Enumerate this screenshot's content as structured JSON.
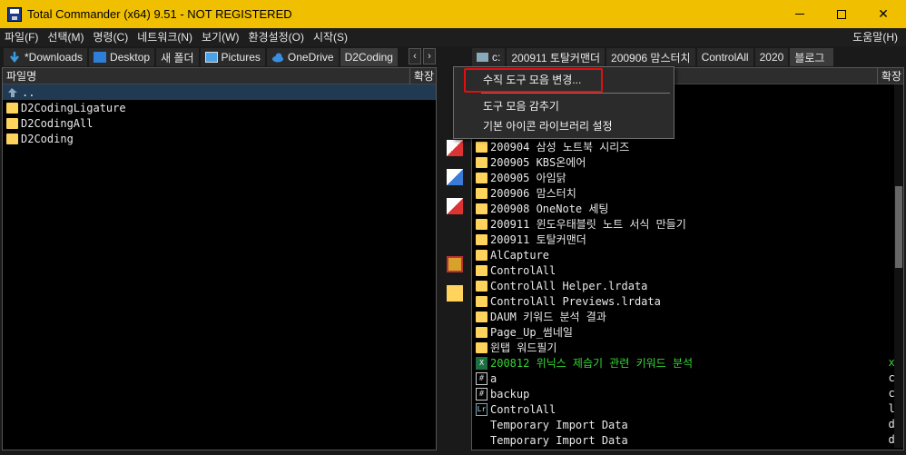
{
  "titlebar": {
    "title": "Total Commander (x64) 9.51 - NOT REGISTERED",
    "minimize_icon": "minimize-icon",
    "maximize_icon": "maximize-icon",
    "close_icon": "close-icon",
    "close_glyph": "✕"
  },
  "menubar": {
    "items": [
      "파일(F)",
      "선택(M)",
      "명령(C)",
      "네트워크(N)",
      "보기(W)",
      "환경설정(O)",
      "시작(S)"
    ],
    "help": "도움말(H)"
  },
  "left_tabs": [
    {
      "label": "*Downloads",
      "icon": "download-arrow-icon",
      "color": "#3a9be0"
    },
    {
      "label": "Desktop",
      "icon": "desktop-icon",
      "color": "#2f7fd8"
    },
    {
      "label": "새 폴더",
      "icon": ""
    },
    {
      "label": "Pictures",
      "icon": "pictures-icon",
      "color": "#4aa3e8"
    },
    {
      "label": "OneDrive",
      "icon": "cloud-icon",
      "color": "#3b8ee0"
    },
    {
      "label": "D2Coding",
      "icon": "",
      "active": true
    }
  ],
  "tab_arrows": {
    "prev": "‹",
    "next": "›"
  },
  "right_tabs": [
    {
      "label": "c:",
      "icon": "drive-icon"
    },
    {
      "label": "200911 토탈커맨더"
    },
    {
      "label": "200906 맘스터치"
    },
    {
      "label": "ControlAll"
    },
    {
      "label": "2020"
    },
    {
      "label": "블로그",
      "active": true
    }
  ],
  "left_panel": {
    "col_name": "파일명",
    "col_ext": "확장",
    "up_label": "..",
    "items": [
      {
        "name": "D2CodingLigature"
      },
      {
        "name": "D2CodingAll"
      },
      {
        "name": "D2Coding"
      }
    ]
  },
  "right_panel": {
    "col_ext": "확장",
    "items": [
      {
        "name": "200904 삼성 노트북 시리즈",
        "type": "folder"
      },
      {
        "name": "200905 KBS온에어",
        "type": "folder"
      },
      {
        "name": "200905 아임닭",
        "type": "folder"
      },
      {
        "name": "200906 맘스터치",
        "type": "folder"
      },
      {
        "name": "200908 OneNote 세팅",
        "type": "folder"
      },
      {
        "name": "200911 윈도우태블릿 노트 서식 만들기",
        "type": "folder"
      },
      {
        "name": "200911 토탈커맨더",
        "type": "folder"
      },
      {
        "name": "AlCapture",
        "type": "folder"
      },
      {
        "name": "ControlAll",
        "type": "folder"
      },
      {
        "name": "ControlAll Helper.lrdata",
        "type": "folder"
      },
      {
        "name": "ControlAll Previews.lrdata",
        "type": "folder"
      },
      {
        "name": "DAUM 키워드 분석 결과",
        "type": "folder"
      },
      {
        "name": "Page_Up_썸네일",
        "type": "folder"
      },
      {
        "name": "윈탭 워드필기",
        "type": "folder"
      },
      {
        "name": "200812 위닉스 제습기 관련 키워드 분석",
        "type": "xl",
        "ext": "xl",
        "green": true
      },
      {
        "name": "a",
        "type": "file",
        "ext": "cs"
      },
      {
        "name": "backup",
        "type": "file",
        "ext": "cs"
      },
      {
        "name": "ControlAll",
        "type": "lr",
        "ext": "lr"
      },
      {
        "name": "Temporary Import Data",
        "type": "plain",
        "ext": "db"
      },
      {
        "name": "Temporary Import Data",
        "type": "plain",
        "ext": "db"
      }
    ]
  },
  "context_menu": {
    "items": [
      "수직 도구 모음 변경...",
      "도구 모음 감추기",
      "기본 아이콘 라이브러리 설정"
    ],
    "highlight_color": "#e01010"
  },
  "vtoolbar": {
    "icons": [
      "delete-file-icon",
      "copy-file-icon",
      "move-file-icon",
      "package-icon",
      "new-folder-icon"
    ]
  }
}
